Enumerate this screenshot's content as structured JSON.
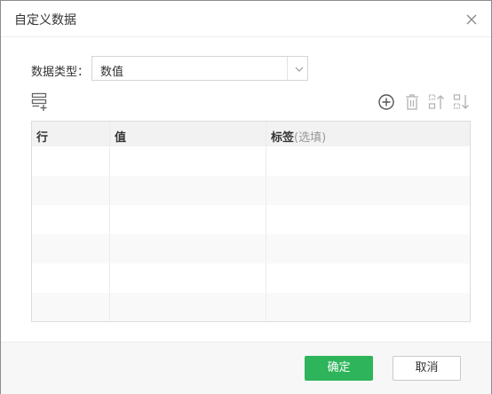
{
  "dialog": {
    "title": "自定义数据",
    "close_icon": "close-icon"
  },
  "form": {
    "data_type_label": "数据类型：",
    "data_type_value": "数值"
  },
  "toolbar": {
    "left_icon": "add-row-list-icon",
    "right_icons": [
      "add-circle-icon",
      "trash-icon",
      "move-up-icon",
      "move-down-icon"
    ]
  },
  "table": {
    "columns": {
      "row": "行",
      "value": "值",
      "label": "标签",
      "label_hint": "(选填)"
    },
    "row_count_visible": 6
  },
  "footer": {
    "ok_label": "确定",
    "cancel_label": "取消"
  },
  "colors": {
    "primary": "#2eb45a",
    "border": "#dcdcdc",
    "header_bg": "#f2f2f2",
    "icon": "#8a8a8a"
  }
}
